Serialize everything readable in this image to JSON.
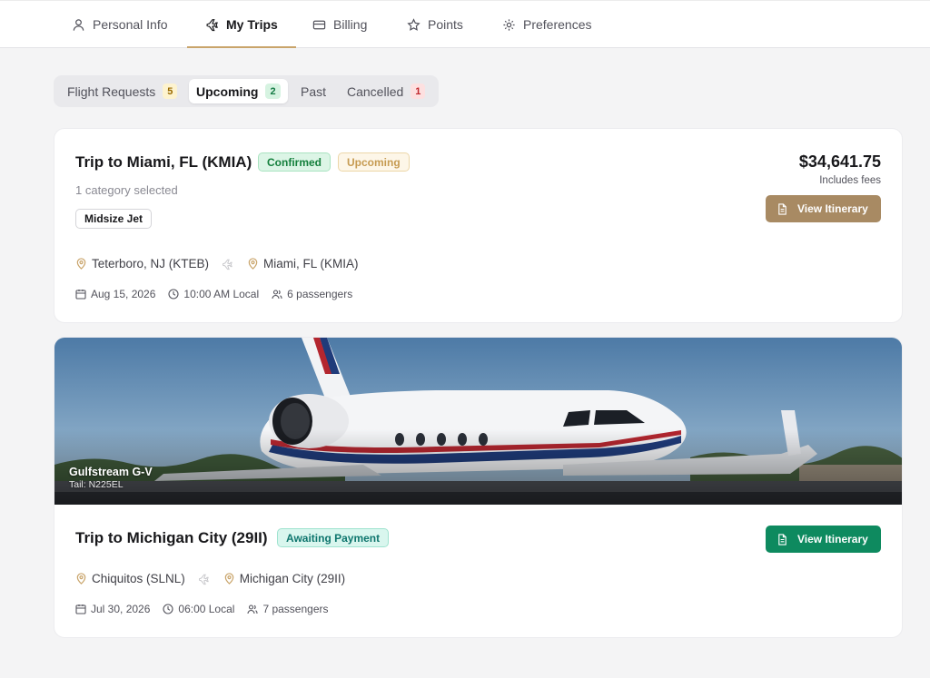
{
  "nav": {
    "tabs": [
      {
        "label": "Personal Info",
        "icon": "user-icon"
      },
      {
        "label": "My Trips",
        "icon": "plane-icon",
        "active": true
      },
      {
        "label": "Billing",
        "icon": "credit-card-icon"
      },
      {
        "label": "Points",
        "icon": "star-icon"
      },
      {
        "label": "Preferences",
        "icon": "gear-icon"
      }
    ],
    "accent": "#c9a46a"
  },
  "filters": [
    {
      "label": "Flight Requests",
      "count": "5",
      "tone": "amber"
    },
    {
      "label": "Upcoming",
      "count": "2",
      "tone": "green",
      "active": true
    },
    {
      "label": "Past"
    },
    {
      "label": "Cancelled",
      "count": "1",
      "tone": "red"
    }
  ],
  "trips": [
    {
      "title": "Trip to Miami, FL (KMIA)",
      "badges": [
        "Confirmed",
        "Upcoming"
      ],
      "category_note": "1 category selected",
      "category": "Midsize Jet",
      "origin": "Teterboro, NJ (KTEB)",
      "destination": "Miami, FL (KMIA)",
      "date": "Aug 15, 2026",
      "time": "10:00 AM Local",
      "passengers": "6 passengers",
      "price": "$34,641.75",
      "price_note": "Includes fees",
      "button": "View Itinerary",
      "button_color": "#a88a63"
    },
    {
      "aircraft": "Gulfstream G-V",
      "tail": "Tail: N225EL",
      "title": "Trip to Michigan City (29II)",
      "badges": [
        "Awaiting Payment"
      ],
      "origin": "Chiquitos (SLNL)",
      "destination": "Michigan City (29II)",
      "date": "Jul 30, 2026",
      "time": "06:00 Local",
      "passengers": "7 passengers",
      "button": "View Itinerary",
      "button_color": "#0e8a5f"
    }
  ]
}
